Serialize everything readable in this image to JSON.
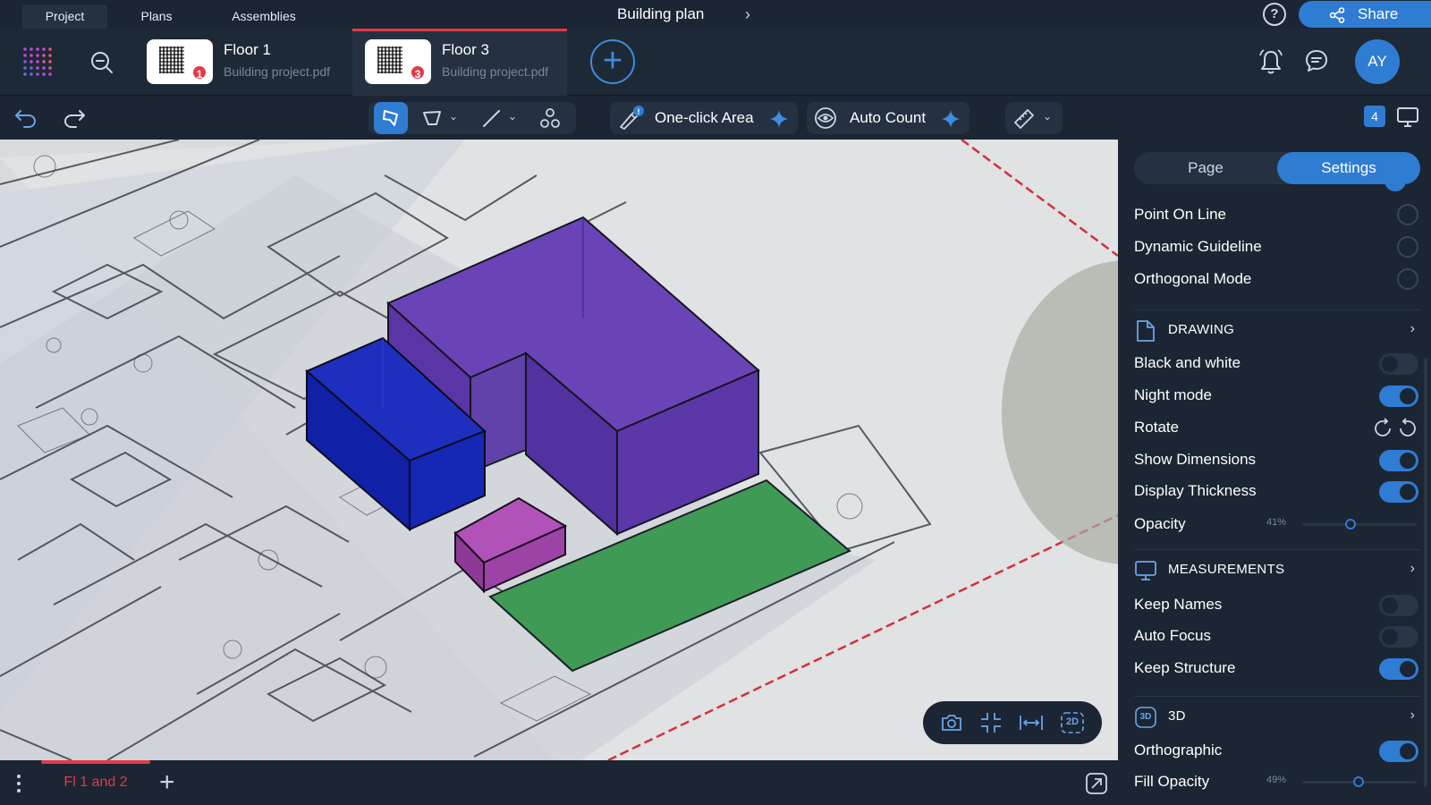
{
  "menu": {
    "tabs": [
      "Project",
      "Plans",
      "Assemblies"
    ],
    "doc_title": "Building plan",
    "share_label": "Share"
  },
  "files": [
    {
      "title": "Floor 1",
      "subtitle": "Building project.pdf",
      "badge": "1"
    },
    {
      "title": "Floor 3",
      "subtitle": "Building project.pdf",
      "badge": "3"
    }
  ],
  "user": {
    "initials": "AY"
  },
  "toolbar": {
    "one_click_label": "One-click Area",
    "auto_count_label": "Auto Count",
    "page_count": "4"
  },
  "bottom": {
    "page_tab": "Fl 1 and 2"
  },
  "panel": {
    "tabs": [
      "Page",
      "Settings"
    ],
    "snapping": [
      {
        "label": "Point On Line"
      },
      {
        "label": "Dynamic Guideline"
      },
      {
        "label": "Orthogonal Mode"
      }
    ],
    "drawing": {
      "title": "DRAWING",
      "rows": [
        {
          "label": "Black and white",
          "on": false
        },
        {
          "label": "Night mode",
          "on": true
        },
        {
          "label": "Rotate"
        },
        {
          "label": "Show Dimensions",
          "on": true
        },
        {
          "label": "Display Thickness",
          "on": true
        },
        {
          "label": "Opacity",
          "value": "41%",
          "fraction": 0.41
        }
      ]
    },
    "measurements": {
      "title": "MEASUREMENTS",
      "rows": [
        {
          "label": "Keep Names",
          "on": false
        },
        {
          "label": "Auto Focus",
          "on": false
        },
        {
          "label": "Keep Structure",
          "on": true
        }
      ]
    },
    "three_d": {
      "title": "3D",
      "icon_text": "3D",
      "rows": [
        {
          "label": "Orthographic",
          "on": true
        },
        {
          "label": "Fill Opacity",
          "value": "49%",
          "fraction": 0.49
        }
      ]
    }
  },
  "view_controls": {
    "mode_2d": "2D"
  }
}
